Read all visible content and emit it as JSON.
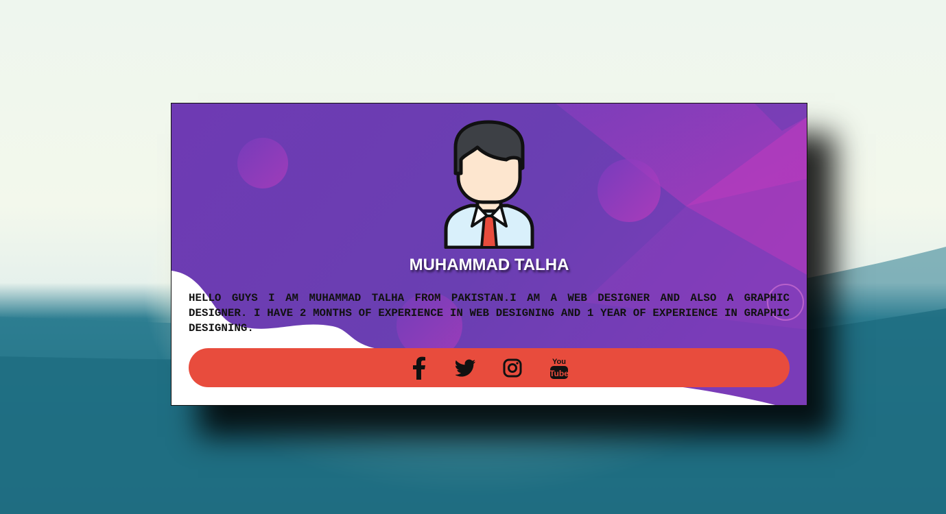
{
  "profile": {
    "name": "MUHAMMAD TALHA",
    "bio": "HELLO GUYS I AM MUHAMMAD TALHA FROM PAKISTAN.I AM A WEB DESIGNER AND ALSO A GRAPHIC DESIGNER. I HAVE 2 MONTHS OF EXPERIENCE IN WEB DESIGNING AND 1 YEAR OF EXPERIENCE IN GRAPHIC DESIGNING.",
    "avatar_icon": "man-avatar-icon"
  },
  "social": {
    "items": [
      {
        "name": "facebook",
        "icon": "facebook-icon"
      },
      {
        "name": "twitter",
        "icon": "twitter-icon"
      },
      {
        "name": "instagram",
        "icon": "instagram-icon"
      },
      {
        "name": "youtube",
        "icon": "youtube-icon",
        "logo_text_top": "You",
        "logo_text_bottom": "Tube"
      }
    ],
    "bar_color": "#e84c3d"
  },
  "colors": {
    "gradient_start": "#6e3ab3",
    "gradient_end": "#c03bbd",
    "text_dark": "#111111"
  }
}
